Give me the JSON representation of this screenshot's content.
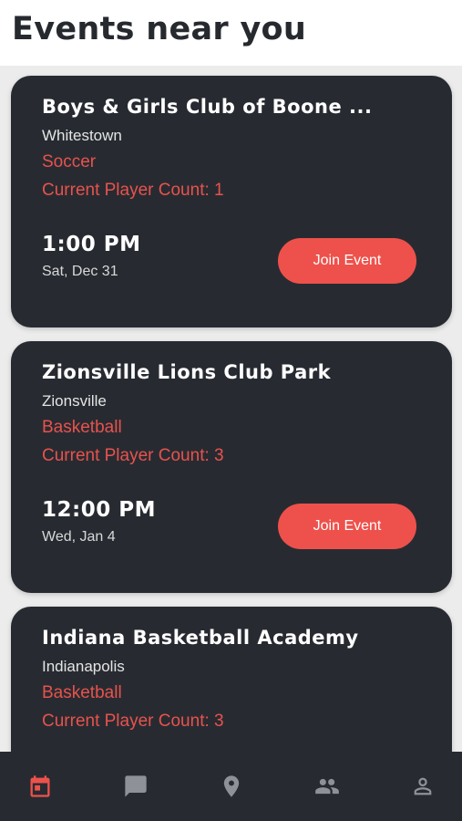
{
  "header": {
    "title": "Events near you"
  },
  "events": [
    {
      "name": "Boys & Girls Club of Boone ...",
      "city": "Whitestown",
      "sport": "Soccer",
      "player_count": "Current Player Count: 1",
      "time": "1:00 PM",
      "date": "Sat, Dec 31",
      "join_label": "Join Event"
    },
    {
      "name": "Zionsville Lions Club Park",
      "city": "Zionsville",
      "sport": "Basketball",
      "player_count": "Current Player Count: 3",
      "time": "12:00 PM",
      "date": "Wed, Jan 4",
      "join_label": "Join Event"
    },
    {
      "name": "Indiana Basketball Academy",
      "city": "Indianapolis",
      "sport": "Basketball",
      "player_count": "Current Player Count: 3",
      "time": "",
      "date": "",
      "join_label": ""
    }
  ],
  "bottom_nav": [
    {
      "icon": "calendar-icon",
      "active": true
    },
    {
      "icon": "chat-icon",
      "active": false
    },
    {
      "icon": "map-pin-icon",
      "active": false
    },
    {
      "icon": "people-icon",
      "active": false
    },
    {
      "icon": "profile-icon",
      "active": false
    }
  ],
  "colors": {
    "accent": "#ee514b",
    "card_bg": "#272b31",
    "nav_inactive": "#8e9197",
    "page_bg": "#ececec"
  }
}
